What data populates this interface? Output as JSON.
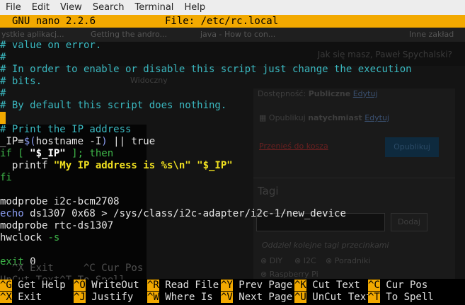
{
  "menubar": {
    "items": [
      "File",
      "Edit",
      "View",
      "Search",
      "Terminal",
      "Help"
    ]
  },
  "title_bar": {
    "app": "GNU nano 2.2.6",
    "file": "File: /etc/rc.local"
  },
  "background_browser": {
    "tabs": [
      "ystkie aplikacj...",
      "Getting the andro...",
      "java - How to con...",
      "Inne zakład"
    ],
    "greeting": "Jak się masz, Paweł Spychalski?",
    "visibility_label": "Widoczny",
    "availability_prefix": "Dostępność:",
    "availability_value": "Publiczne",
    "availability_link": "Edytuj",
    "publish_prefix": "Opublikuj",
    "publish_value": "natychmiast",
    "publish_link": "Edytuj",
    "trash_link": "Przenieś do kosza",
    "publish_button": "Opublikuj",
    "tags_heading": "Tagi",
    "add_button": "Dodaj",
    "tags_hint": "Oddziel kolejne tagi przecinkami",
    "tag_options": [
      "DIY",
      "I2C",
      "Poradniki",
      "Raspberry Pi"
    ]
  },
  "editor": {
    "lines": [
      {
        "segments": [
          {
            "text": "# value on error.",
            "cls": "c-cyan"
          }
        ]
      },
      {
        "segments": [
          {
            "text": "#",
            "cls": "c-cyan"
          }
        ]
      },
      {
        "segments": [
          {
            "text": "# In order to enable or disable this script just change the execution",
            "cls": "c-cyan"
          }
        ]
      },
      {
        "segments": [
          {
            "text": "# bits.",
            "cls": "c-cyan"
          }
        ]
      },
      {
        "segments": [
          {
            "text": "#",
            "cls": "c-cyan"
          }
        ]
      },
      {
        "segments": [
          {
            "text": "# By default this script does nothing.",
            "cls": "c-cyan"
          }
        ]
      },
      {
        "segments": []
      },
      {
        "segments": [
          {
            "text": "# Print the IP address",
            "cls": "c-cyan"
          }
        ]
      },
      {
        "segments": [
          {
            "text": "_IP=",
            "cls": "c-white"
          },
          {
            "text": "$(",
            "cls": "c-blue"
          },
          {
            "text": "hostname -I",
            "cls": "c-white"
          },
          {
            "text": ")",
            "cls": "c-blue"
          },
          {
            "text": " || true",
            "cls": "c-white"
          }
        ]
      },
      {
        "segments": [
          {
            "text": "if",
            "cls": "c-green"
          },
          {
            "text": " [ ",
            "cls": "c-green"
          },
          {
            "text": "\"$_IP\"",
            "cls": "c-white-b"
          },
          {
            "text": " ]; then",
            "cls": "c-green"
          }
        ]
      },
      {
        "segments": [
          {
            "text": "  printf ",
            "cls": "c-white"
          },
          {
            "text": "\"My IP address is %s\\n\" \"$_IP\"",
            "cls": "c-yellow"
          }
        ]
      },
      {
        "segments": [
          {
            "text": "fi",
            "cls": "c-green"
          }
        ]
      },
      {
        "segments": []
      },
      {
        "segments": [
          {
            "text": "modprobe i2c-bcm2708",
            "cls": "c-white"
          }
        ]
      },
      {
        "segments": [
          {
            "text": "echo",
            "cls": "c-blue"
          },
          {
            "text": " ds1307 0x68 > /sys/class/i2c-adapter/i2c-1/new_device",
            "cls": "c-white"
          }
        ]
      },
      {
        "segments": [
          {
            "text": "modprobe rtc-ds1307",
            "cls": "c-white"
          }
        ]
      },
      {
        "segments": [
          {
            "text": "hwclock ",
            "cls": "c-white"
          },
          {
            "text": "-s",
            "cls": "c-green"
          }
        ]
      },
      {
        "segments": []
      },
      {
        "segments": [
          {
            "text": "exit",
            "cls": "c-green"
          },
          {
            "text": " 0",
            "cls": "c-white"
          }
        ]
      },
      {
        "segments": []
      }
    ],
    "ghost_lines": [
      {
        "row": 19,
        "text": "  ^X Exit     ^C Cur Pos"
      },
      {
        "row": 20,
        "text": "UnCut Text^T To Spell"
      }
    ]
  },
  "shortcuts": {
    "row1": [
      {
        "key": "^G",
        "label": "Get Help"
      },
      {
        "key": "^O",
        "label": "WriteOut"
      },
      {
        "key": "^R",
        "label": "Read File"
      },
      {
        "key": "^Y",
        "label": "Prev Page"
      },
      {
        "key": "^K",
        "label": "Cut Text"
      },
      {
        "key": "^C",
        "label": "Cur Pos"
      }
    ],
    "row2": [
      {
        "key": "^X",
        "label": "Exit"
      },
      {
        "key": "^J",
        "label": "Justify"
      },
      {
        "key": "^W",
        "label": "Where Is"
      },
      {
        "key": "^V",
        "label": "Next Page"
      },
      {
        "key": "^U",
        "label": "UnCut Text"
      },
      {
        "key": "^T",
        "label": "To Spell"
      }
    ]
  },
  "colors": {
    "nano_accent": "#f2a900",
    "comment": "#3ab8c0",
    "string": "#f0e020",
    "keyword": "#3fb84a",
    "builtin": "#8a9cf0"
  }
}
